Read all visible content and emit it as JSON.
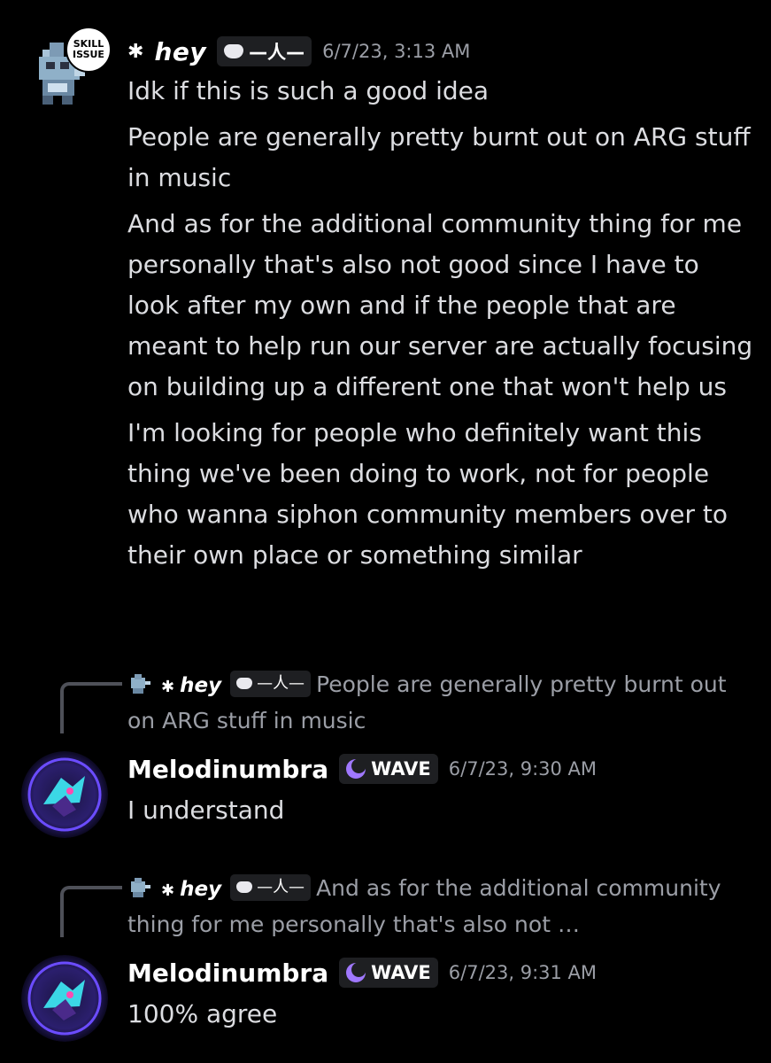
{
  "messages": [
    {
      "author": "hey",
      "tag": "—人—",
      "timestamp": "6/7/23, 3:13 AM",
      "avatar_badge": [
        "SKILL",
        "ISSUE"
      ],
      "paragraphs": [
        "Idk if this is such a good idea",
        "People are generally pretty burnt out on ARG stuff in music",
        "And as for the additional community thing for me personally that's also not good since I have to look after my own and if the people that are meant to help run our server are actually focusing on building up a different one that won't help us",
        "I'm looking for people who definitely want this thing we've been doing to work, not for people who wanna siphon community members over to their own place or something similar"
      ]
    },
    {
      "reply": {
        "author": "hey",
        "tag": "—人—",
        "text": "People are generally pretty burnt out on ARG stuff in music"
      },
      "author": "Melodinumbra",
      "tag": "WAVE",
      "timestamp": "6/7/23, 9:30 AM",
      "paragraphs": [
        "I understand"
      ]
    },
    {
      "reply": {
        "author": "hey",
        "tag": "—人—",
        "text": "And as for the additional community thing for me personally that's also not …"
      },
      "author": "Melodinumbra",
      "tag": "WAVE",
      "timestamp": "6/7/23, 9:31 AM",
      "paragraphs": [
        "100% agree"
      ]
    }
  ],
  "colors": {
    "background": "#000000",
    "text": "#dcdde1",
    "muted": "#9b9ea6",
    "tag_bg": "#1e1f22",
    "accent_purple": "#a078ff"
  }
}
